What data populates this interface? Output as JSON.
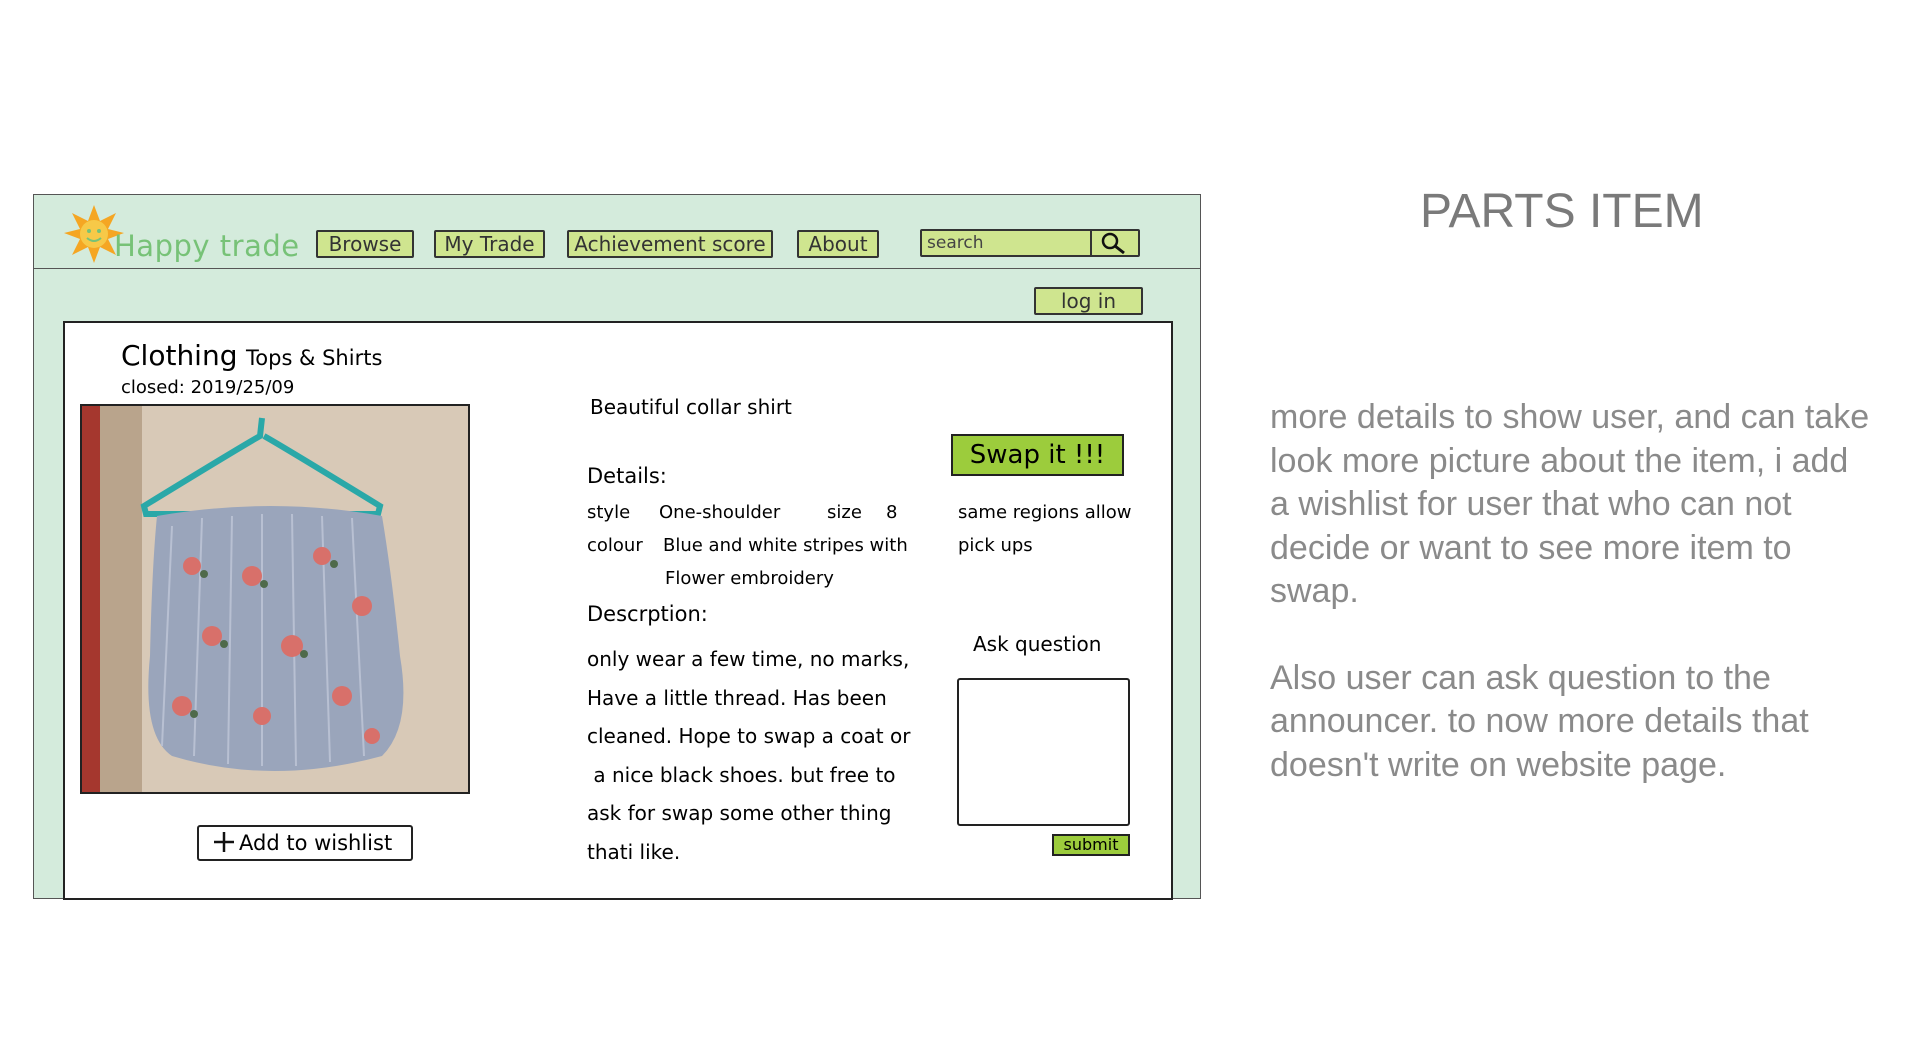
{
  "app": {
    "logo_text": "Happy trade"
  },
  "nav": {
    "items": [
      {
        "label": "Browse"
      },
      {
        "label": "My Trade"
      },
      {
        "label": "Achievement score"
      },
      {
        "label": "About"
      }
    ],
    "search_placeholder": "search",
    "login_label": "log in"
  },
  "item": {
    "category": "Clothing",
    "subcategory": "Tops & Shirts",
    "closed": "closed: 2019/25/09",
    "name": "Beautiful collar shirt",
    "details_heading": "Details:",
    "style_label": "style",
    "style_value": "One-shoulder",
    "size_label": "size",
    "size_value": "8",
    "colour_label": "colour",
    "colour_value_1": "Blue and white stripes with",
    "colour_value_2": "Flower embroidery",
    "region_1": "same regions allow",
    "region_2": "pick ups",
    "description_heading": "Descrption:",
    "description_lines": [
      "only wear a few time, no marks,",
      "Have a little thread. Has been",
      "cleaned. Hope to swap a coat or",
      " a nice black shoes. but free to",
      "ask for swap some other thing",
      "thati like."
    ],
    "wishlist_label": "Add to wishlist",
    "swap_label": "Swap it !!!",
    "ask_label": "Ask question",
    "submit_label": "submit"
  },
  "annotation": {
    "title": "PARTS ITEM",
    "paragraph_1": "more details to show user, and can take look more picture about the item, i add a wishlist for user that who can not decide or want to see more item to swap.",
    "paragraph_2": "Also user can ask question to the announcer. to now more details that doesn't write on website page."
  },
  "colors": {
    "wire_bg": "#d4ebdc",
    "button_bg": "#cfe58f",
    "swap_bg": "#9ccc3c",
    "logo_text": "#77c277",
    "annotation_text": "#8a8a8a"
  },
  "icons": [
    "sun-logo-icon",
    "search-icon",
    "plus-icon"
  ]
}
